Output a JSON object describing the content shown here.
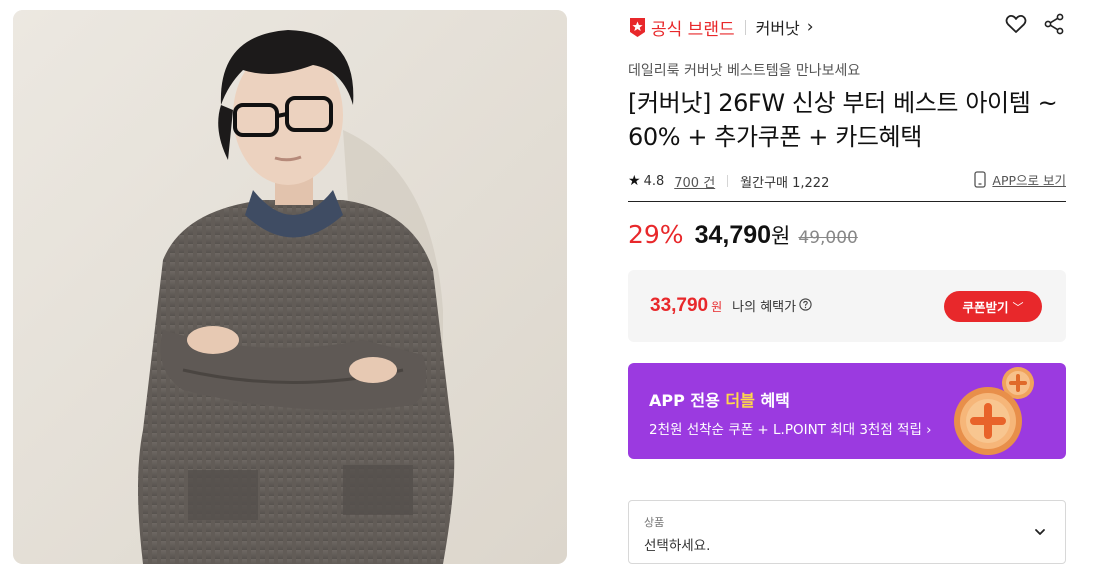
{
  "brand": {
    "official_label": "공식 브랜드",
    "name": "커버낫",
    "chevron": "›",
    "badge_icon": "official-brand-badge",
    "accent_color": "#e8282b"
  },
  "actions": {
    "like_icon": "heart-icon",
    "share_icon": "share-icon"
  },
  "product": {
    "subtitle": "데일리룩 커버낫 베스트템을 만나보세요",
    "title": "[커버낫] 26FW 신상 부터 베스트 아이템 ~ 60% + 추가쿠폰 + 카드혜택",
    "rating": "4.8",
    "review_count": "700 건",
    "monthly_sales": "월간구매 1,222",
    "app_view_label": "APP으로 보기"
  },
  "price": {
    "discount": "29%",
    "amount": "34,790",
    "currency": "원",
    "original": "49,000"
  },
  "benefit": {
    "amount": "33,790",
    "currency": "원",
    "label": "나의 혜택가",
    "coupon_button": "쿠폰받기",
    "coupon_chevron": "﹀"
  },
  "app_banner": {
    "title_prefix": "APP 전용 ",
    "title_highlight": "더블",
    "title_suffix": " 혜택",
    "subtitle": "2천원 선착순 쿠폰 + L.POINT 최대 3천점 적립 ›",
    "background": "#9b3ae0",
    "highlight_color": "#ffd84a"
  },
  "option": {
    "label": "상품",
    "placeholder": "선택하세요."
  }
}
